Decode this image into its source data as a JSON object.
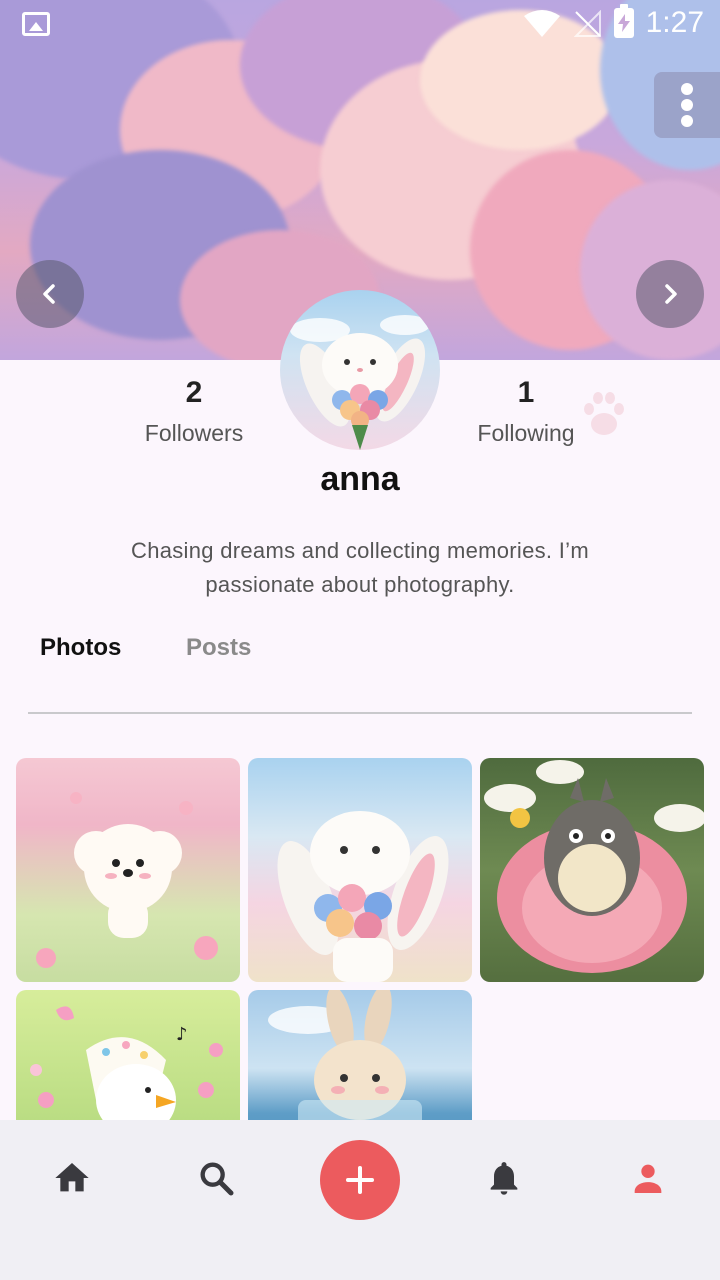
{
  "status_bar": {
    "time": "1:27",
    "icons": [
      "image-icon",
      "wifi-icon",
      "no-signal-icon",
      "battery-charging-icon"
    ]
  },
  "cover": {
    "menu_icon": "more-vertical-icon",
    "prev_icon": "chevron-left-icon",
    "next_icon": "chevron-right-icon"
  },
  "profile": {
    "followers_count": "2",
    "followers_label": "Followers",
    "following_count": "1",
    "following_label": "Following",
    "username": "anna",
    "bio": "Chasing dreams and collecting memories. I’m passionate about photography."
  },
  "tabs": [
    {
      "label": "Photos",
      "selected": true
    },
    {
      "label": "Posts",
      "selected": false
    }
  ],
  "photos": [
    "white-poodle-in-pink-flowers",
    "bunny-holding-hydrangea-bouquet",
    "totoro-in-pink-flower",
    "duck-with-floral-scarf",
    "bunny-in-glass-at-beach"
  ],
  "bottom_nav": [
    {
      "icon": "home-icon"
    },
    {
      "icon": "search-icon"
    },
    {
      "icon": "add-icon"
    },
    {
      "icon": "bell-icon"
    },
    {
      "icon": "profile-icon",
      "active": true
    }
  ],
  "colors": {
    "accent": "#ec5b5e",
    "background": "#fcf6fd",
    "nav_background": "#f0eff4"
  }
}
